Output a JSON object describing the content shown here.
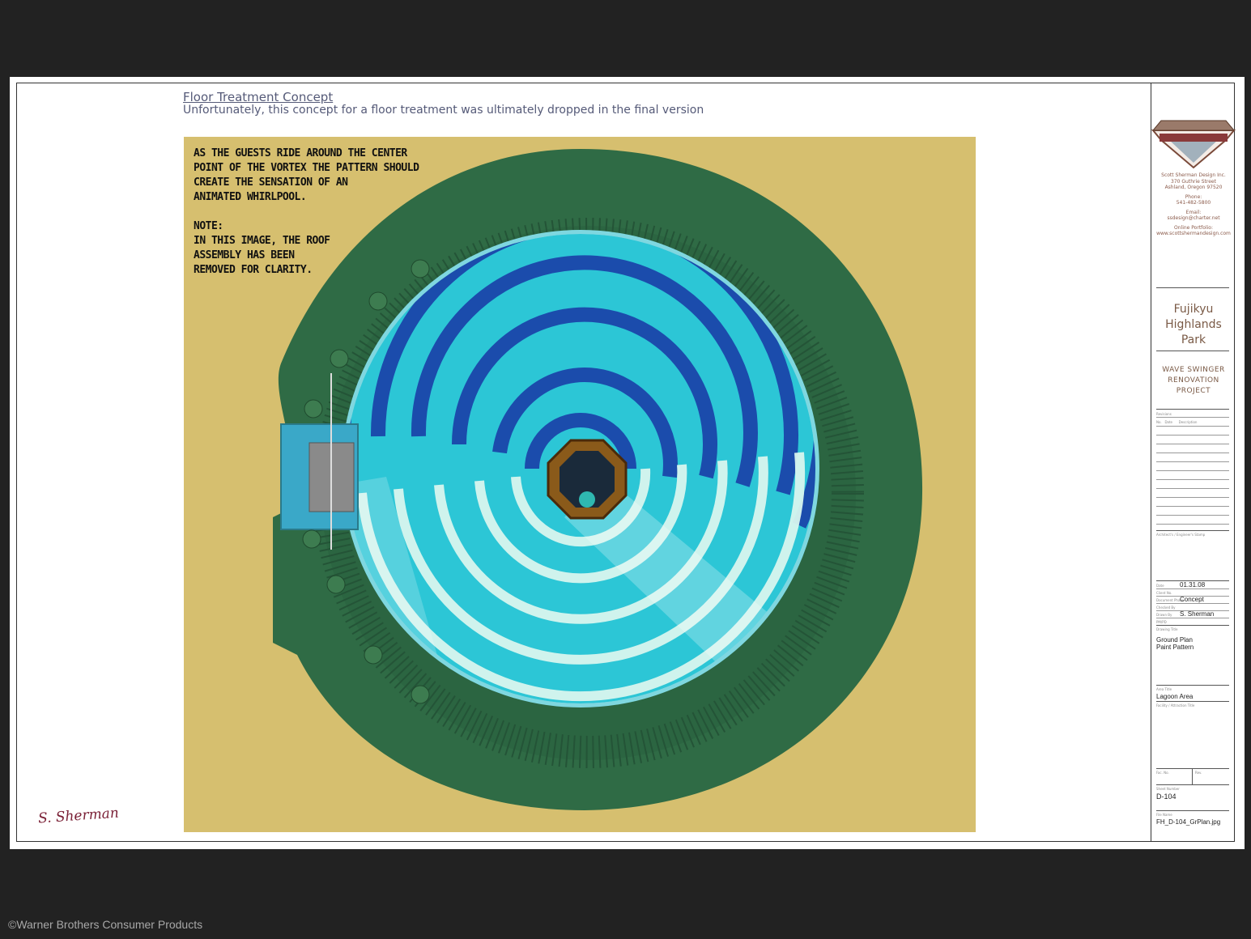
{
  "caption": {
    "title": "Floor Treatment Concept",
    "subtitle": "Unfortunately, this concept for a floor treatment was ultimately dropped in the final version"
  },
  "artwork": {
    "note": "AS THE GUESTS RIDE AROUND THE CENTER\nPOINT OF THE VORTEX THE PATTERN SHOULD\nCREATE THE SENSATION OF AN\nANIMATED WHIRLPOOL.\n\nNOTE:\nIN THIS IMAGE, THE ROOF\nASSEMBLY HAS BEEN\nREMOVED FOR CLARITY.",
    "colors": {
      "background": "#d6bf6f",
      "lawn": "#2f6b45",
      "pool_light": "#2fd0d0",
      "pool_dark": "#1a3fa8",
      "swirl": "#d8f6ef"
    }
  },
  "signature": "S. Sherman",
  "titleblock": {
    "company": "SCOTT SHERMAN DESIGN",
    "contact_lines": [
      "Scott Sherman Design Inc.",
      "370 Guthrie Street",
      "Ashland, Oregon 97520",
      "",
      "Phone:",
      "541-482-5800",
      "",
      "Email:",
      "ssdesign@charter.net",
      "",
      "Online Portfolio:",
      "www.scottshermandesign.com"
    ],
    "park": "Fujikyu\nHighlands\nPark",
    "project": "WAVE SWINGER\nRENOVATION\nPROJECT",
    "revisions_label": "Revisions",
    "rev_cols": "No.   Date      Description",
    "stamp_label": "Architect's / Engineer's Stamp",
    "date_label": "Date",
    "date": "01.31.08",
    "client_label": "Client No.",
    "phase_label": "Document Phase",
    "phase": "Concept",
    "checked_label": "Checked By",
    "drawn_label": "Drawn By",
    "drawn": "S. Sherman",
    "pmpd_label": "PM/PD",
    "drawing_title_label": "Drawing Title",
    "drawing_title": "Ground Plan\nPaint Pattern",
    "area_label": "Area Title",
    "area": "Lagoon Area",
    "facility_label": "Facility / Attraction Title",
    "fac_no_label": "Fac. No.",
    "rev_label": "Rev.",
    "sheet_label": "Sheet Number",
    "sheet": "D-104",
    "file_label": "File Name",
    "file": "FH_D-104_GrPlan.jpg"
  },
  "copyright": "©Warner Brothers Consumer Products"
}
